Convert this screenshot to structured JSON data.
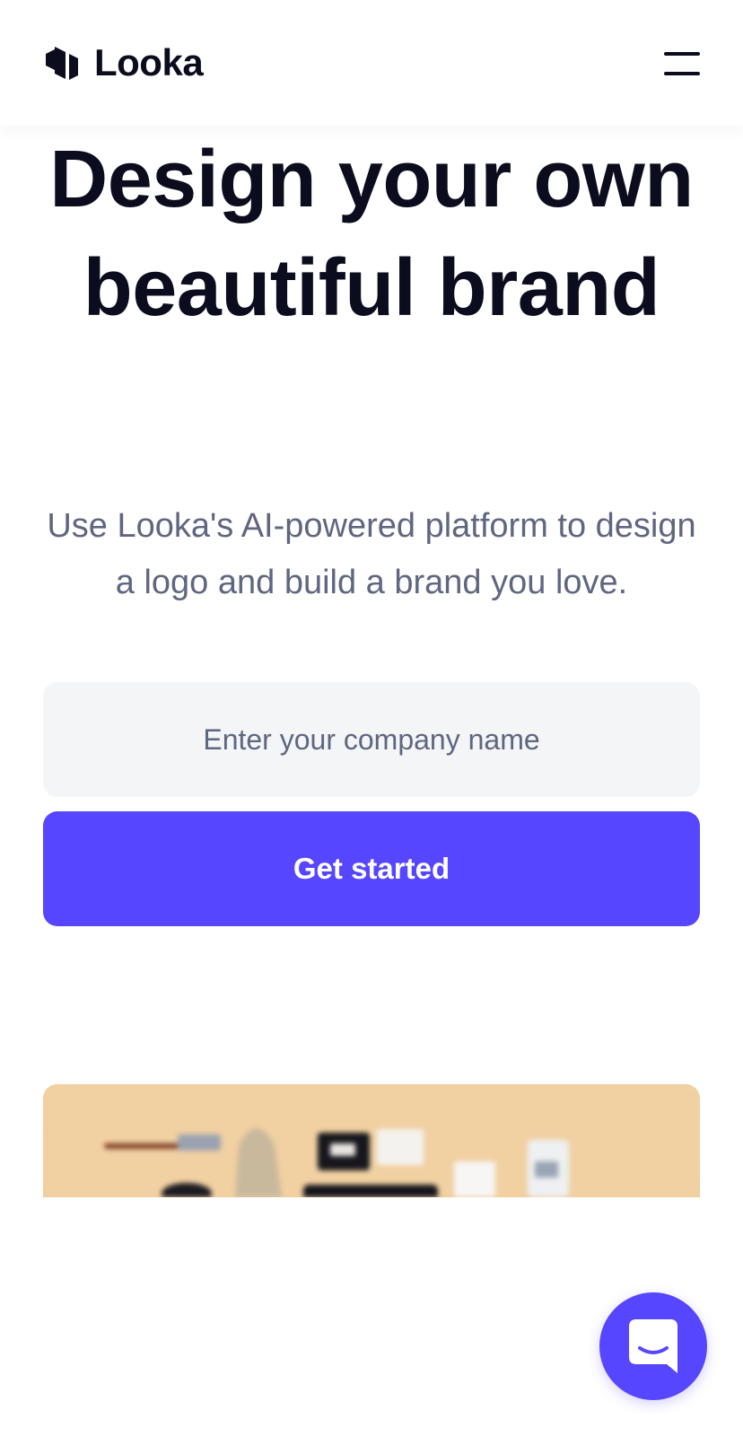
{
  "header": {
    "brand_name": "Looka",
    "logo_icon": "looka-hexagon-logo",
    "menu_icon": "hamburger-menu-icon"
  },
  "hero": {
    "title": "Design your own beautiful brand",
    "subtitle": "Use Looka's AI-powered platform to design a logo and build a brand you love."
  },
  "signup_form": {
    "company_input_placeholder": "Enter your company name",
    "company_input_value": "",
    "cta_label": "Get started"
  },
  "preview": {
    "image_subject": "brand-mockup-products-photo"
  },
  "chat": {
    "icon": "chat-bubble-icon"
  },
  "colors": {
    "primary": "#5646ff",
    "heading_text": "#0b0d1e",
    "body_text": "#5f6680",
    "input_background": "#f3f5f7",
    "preview_background": "#f0cfa0"
  }
}
